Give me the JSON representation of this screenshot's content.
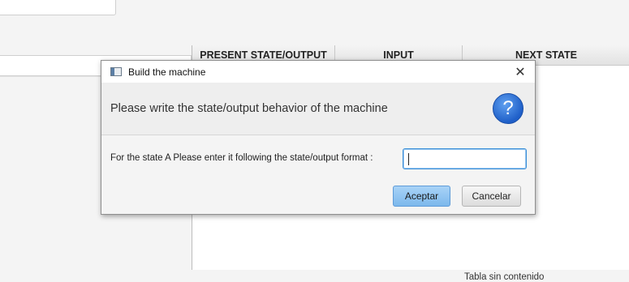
{
  "table": {
    "columns": [
      "PRESENT STATE/OUTPUT",
      "INPUT",
      "NEXT STATE"
    ],
    "empty_message": "Tabla sin contenido"
  },
  "dialog": {
    "title": "Build the machine",
    "close_glyph": "✕",
    "header_text": "Please write the state/output behavior of the machine",
    "help_glyph": "?",
    "prompt": "For the state A Please enter it following the state/output format :",
    "input_value": "",
    "accept_label": "Aceptar",
    "cancel_label": "Cancelar"
  },
  "colors": {
    "accent": "#3c8fd8",
    "help_icon": "#1f5fc8"
  }
}
